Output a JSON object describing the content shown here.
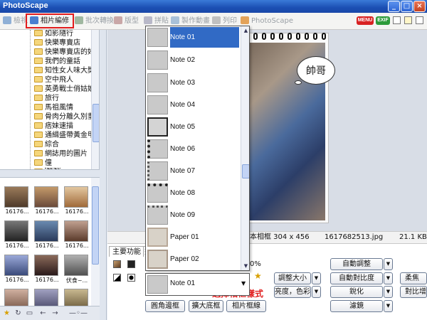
{
  "app": {
    "title": "PhotoScape"
  },
  "window_buttons": [
    "_",
    "□",
    "×"
  ],
  "toolbar": {
    "tabs": [
      {
        "label": "檢視",
        "active": false
      },
      {
        "label": "相片編修",
        "active": true
      },
      {
        "label": "批次轉換",
        "active": false
      },
      {
        "label": "版型",
        "active": false
      },
      {
        "label": "拼貼",
        "active": false
      },
      {
        "label": "製作動畫",
        "active": false
      },
      {
        "label": "列印",
        "active": false
      },
      {
        "label": "PhotoScape",
        "active": false
      }
    ],
    "badges": {
      "menu": "MENU",
      "exif": "EXIF"
    }
  },
  "tree": {
    "items": [
      {
        "label": "如影隨行"
      },
      {
        "label": "快樂專賣店"
      },
      {
        "label": "快樂專賣店的好"
      },
      {
        "label": "我們的童話"
      },
      {
        "label": "知性女人味大獎"
      },
      {
        "label": "空中飛人"
      },
      {
        "label": "英勇戰士俏姑娘"
      },
      {
        "label": "旅行"
      },
      {
        "label": "馬祖風情"
      },
      {
        "label": "骨肉分離久別重"
      },
      {
        "label": "痞妹速描"
      },
      {
        "label": "通緝盛帶黃金甲"
      },
      {
        "label": "綜合"
      },
      {
        "label": "網誌用的圖片"
      },
      {
        "label": "僮"
      },
      {
        "label": "戲劇",
        "selected": true
      },
      {
        "label": "戲劇人物"
      }
    ]
  },
  "thumbnails": [
    {
      "caption": "16176..."
    },
    {
      "caption": "16176..."
    },
    {
      "caption": "16176..."
    },
    {
      "caption": "16176..."
    },
    {
      "caption": "16176..."
    },
    {
      "caption": "16176..."
    },
    {
      "caption": "16176..."
    },
    {
      "caption": "16176..."
    },
    {
      "caption": "伏食~..."
    },
    {
      "caption": ""
    },
    {
      "caption": ""
    },
    {
      "caption": ""
    }
  ],
  "photo": {
    "speech_text": "帥哥"
  },
  "infobar": {
    "frame_info": "本相框 304 x 456",
    "filename": "1617682513.jpg",
    "filesize": "21.1 KB"
  },
  "panel": {
    "tabs": [
      "主要功能",
      "畫"
    ],
    "percent": "0%",
    "buttons": {
      "resize": "調整大小",
      "brightness": "亮度，色彩",
      "auto_level": "自動調整",
      "auto_contrast": "自動對比度",
      "sharpen": "銳化",
      "filter": "濾鏡",
      "right1": "柔焦",
      "right2": "對比增",
      "round_frame": "圓角邊框",
      "expand_bg": "擴大底框",
      "photo_frame": "相片框線"
    },
    "hint": "選擇相框樣式"
  },
  "dropdown": {
    "items": [
      {
        "label": "Note 01",
        "selected": true
      },
      {
        "label": "Note 02"
      },
      {
        "label": "Note 03"
      },
      {
        "label": "Note 04"
      },
      {
        "label": "Note 05"
      },
      {
        "label": "Note 06"
      },
      {
        "label": "Note 07"
      },
      {
        "label": "Note 08"
      },
      {
        "label": "Note 09"
      },
      {
        "label": "Paper 01"
      },
      {
        "label": "Paper 02"
      }
    ],
    "current_value": "Note 01"
  }
}
